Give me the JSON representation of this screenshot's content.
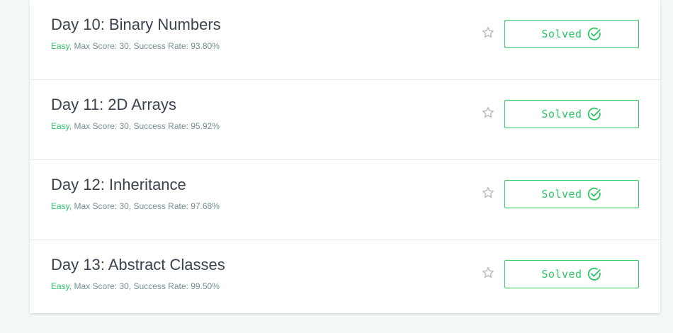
{
  "challenges": [
    {
      "title": "Day 10: Binary Numbers",
      "difficulty": "Easy,",
      "meta": " Max Score: 30, Success Rate: 93.80%",
      "status_label": "Solved"
    },
    {
      "title": "Day 11: 2D Arrays",
      "difficulty": "Easy,",
      "meta": " Max Score: 30, Success Rate: 95.92%",
      "status_label": "Solved"
    },
    {
      "title": "Day 12: Inheritance",
      "difficulty": "Easy,",
      "meta": " Max Score: 30, Success Rate: 97.68%",
      "status_label": "Solved"
    },
    {
      "title": "Day 13: Abstract Classes",
      "difficulty": "Easy,",
      "meta": " Max Score: 30, Success Rate: 99.50%",
      "status_label": "Solved"
    }
  ],
  "icons": {
    "star": "star-outline-icon",
    "solved": "check-circle-icon"
  },
  "colors": {
    "accent": "#2ec866",
    "title": "#39424e",
    "meta": "#738f93",
    "star": "#b7c0c6",
    "background": "#f3f7f7"
  }
}
